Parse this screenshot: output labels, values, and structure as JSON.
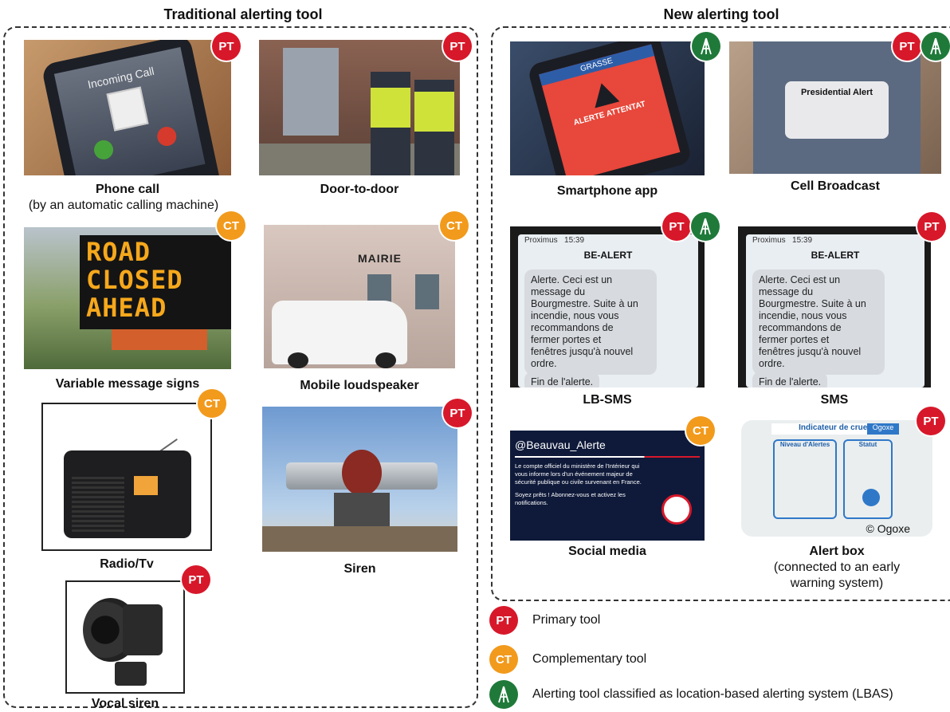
{
  "headings": {
    "traditional": "Traditional alerting tool",
    "new": "New alerting tool"
  },
  "traditional_tools": [
    {
      "name": "Phone call",
      "note": "(by an automatic calling machine)",
      "badges": [
        "PT"
      ]
    },
    {
      "name": "Door-to-door",
      "badges": [
        "PT"
      ]
    },
    {
      "name": "Variable message signs",
      "badges": [
        "CT"
      ]
    },
    {
      "name": "Mobile loudspeaker",
      "badges": [
        "CT"
      ]
    },
    {
      "name": "Radio/Tv",
      "badges": [
        "CT"
      ]
    },
    {
      "name": "Siren",
      "badges": [
        "PT"
      ]
    },
    {
      "name": "Vocal siren",
      "badges": [
        "PT"
      ]
    }
  ],
  "new_tools": [
    {
      "name": "Smartphone app",
      "badges": [
        "LBAS"
      ]
    },
    {
      "name": "Cell Broadcast",
      "badges": [
        "PT",
        "LBAS"
      ]
    },
    {
      "name": "LB-SMS",
      "badges": [
        "PT",
        "LBAS"
      ]
    },
    {
      "name": "SMS",
      "badges": [
        "PT"
      ]
    },
    {
      "name": "Social media",
      "badges": [
        "CT"
      ]
    },
    {
      "name": "Alert box",
      "note_line1": "(connected to an early",
      "note_line2": "warning system)",
      "badges": [
        "PT"
      ]
    }
  ],
  "badge_text": {
    "pt": "PT",
    "ct": "CT"
  },
  "legend": {
    "pt": "Primary tool",
    "ct": "Complementary tool",
    "lbas": "Alerting tool classified as location-based alerting system (LBAS)"
  },
  "image_text": {
    "phone_incoming": "Incoming Call",
    "road_sign": [
      "ROAD",
      "CLOSED",
      "AHEAD"
    ],
    "mairie": "MAIRIE",
    "app_city": "GRASSE",
    "app_alert": "ALERTE ATTENTAT",
    "cb_title": "Presidential Alert",
    "sms_header": "BE-ALERT",
    "sms_carrier": "Proximus",
    "sms_time": "15:39",
    "sms_body": "Alerte. Ceci est un\nmessage du\nBourgmestre. Suite à un\nincendie, nous vous\nrecommandons de\nfermer portes et\nfenêtres jusqu'à nouvel\nordre.",
    "sms_end": "Fin de l'alerte.",
    "social_handle": "@Beauvau_Alerte",
    "social_text1": "Le compte officiel du ministère de l'Intérieur qui vous informe lors d'un événement majeur de sécurité publique ou civile survenant en France.",
    "social_text2": "Soyez prêts ! Abonnez-vous et activez les notifications.",
    "alertbox_title": "Indicateur de crues",
    "alertbox_brand": "Ogoxe",
    "alertbox_level": "Niveau d'Alertes",
    "alertbox_status": "Statut",
    "copyright": "© Ogoxe"
  },
  "colors": {
    "pt": "#d7182a",
    "ct": "#f29a1c",
    "lbas": "#1f7a3a"
  }
}
